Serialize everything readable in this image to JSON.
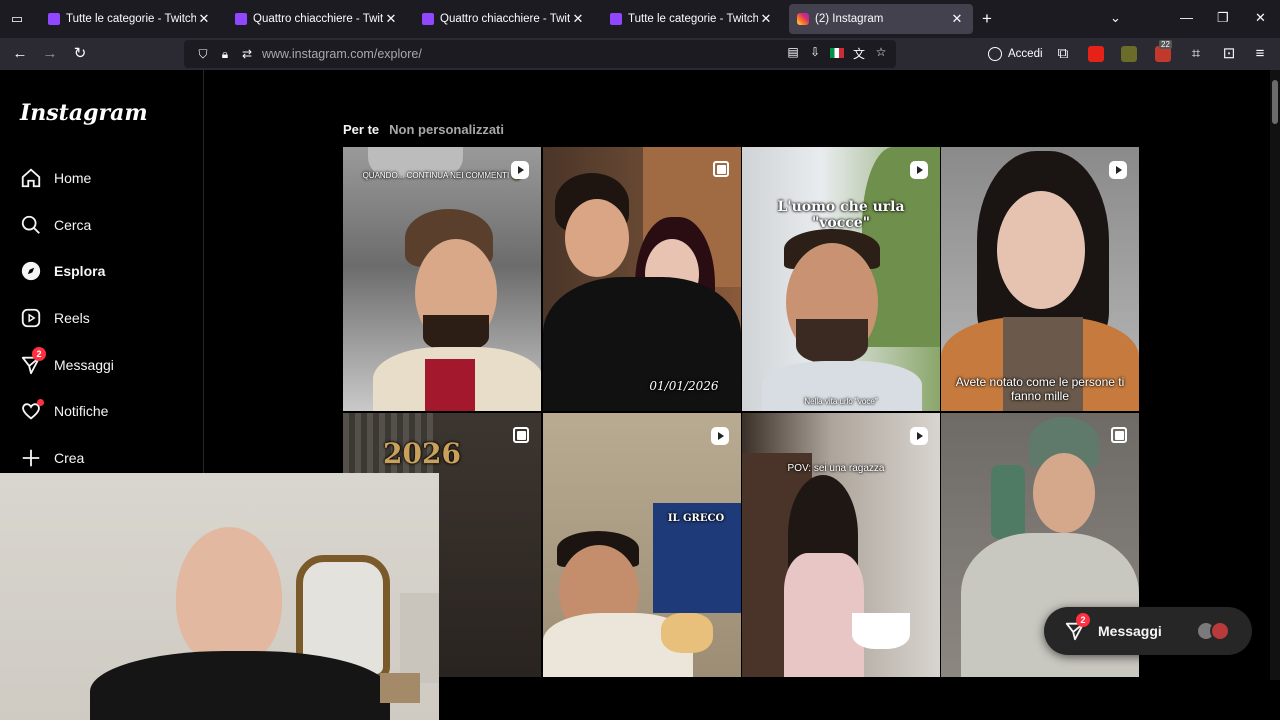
{
  "browser": {
    "tabs": [
      {
        "title": "Tutte le categorie - Twitch",
        "favicon": "twitch-icon",
        "active": false
      },
      {
        "title": "Quattro chiacchiere - Twitch",
        "favicon": "twitch-icon",
        "active": false
      },
      {
        "title": "Quattro chiacchiere - Twitch",
        "favicon": "twitch-icon",
        "active": false
      },
      {
        "title": "Tutte le categorie - Twitch",
        "favicon": "twitch-icon",
        "active": false
      },
      {
        "title": "(2) Instagram",
        "favicon": "instagram-icon",
        "active": true
      }
    ],
    "tab_close_glyph": "✕",
    "new_tab_glyph": "+",
    "url": {
      "host": "www.instagram.com",
      "path": "/explore/"
    },
    "signin_label": "Accedi",
    "extension_badge": "22",
    "accent": "#42414d"
  },
  "instagram": {
    "logo": "Instagram",
    "nav": [
      {
        "label": "Home",
        "icon": "home-icon"
      },
      {
        "label": "Cerca",
        "icon": "search-icon"
      },
      {
        "label": "Esplora",
        "icon": "compass-icon",
        "active": true
      },
      {
        "label": "Reels",
        "icon": "reels-icon"
      },
      {
        "label": "Messaggi",
        "icon": "messages-icon",
        "badge": "2"
      },
      {
        "label": "Notifiche",
        "icon": "heart-icon",
        "dot": true
      },
      {
        "label": "Crea",
        "icon": "plus-icon"
      }
    ],
    "explore_tabs": [
      {
        "label": "Per te",
        "active": true
      },
      {
        "label": "Non personalizzati",
        "active": false
      }
    ],
    "tiles": [
      {
        "type": "reel",
        "caption": "QUANDO... CONTINUA NEI COMMENTI 😂"
      },
      {
        "type": "carousel",
        "caption": "01/01/2026"
      },
      {
        "type": "reel",
        "caption": "L'uomo che urla \"vocce\"",
        "subcaption": "Nella vita urlo \"voce\""
      },
      {
        "type": "reel",
        "caption": "Avete notato come le persone ti fanno mille"
      },
      {
        "type": "carousel",
        "caption": "2026"
      },
      {
        "type": "reel",
        "caption": "IL GRECO"
      },
      {
        "type": "reel",
        "caption": "POV: sei una ragazza"
      },
      {
        "type": "carousel",
        "caption": ""
      }
    ],
    "messages_bubble": {
      "label": "Messaggi",
      "badge": "2"
    },
    "colors": {
      "badge": "#ff3040",
      "background": "#000000",
      "text": "#f5f5f5",
      "muted": "#a8a8a8"
    }
  }
}
